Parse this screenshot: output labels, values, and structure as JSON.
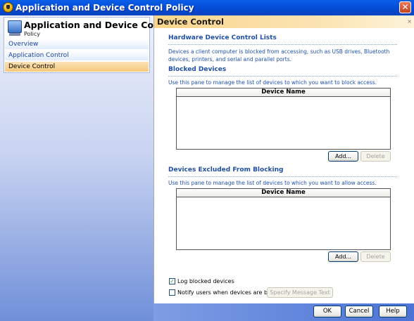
{
  "window": {
    "title": "Application and Device Control Policy",
    "close_glyph": "✕",
    "app_icon": "shield-icon"
  },
  "nav": {
    "heading": "Application and Device Control",
    "subheading": "Policy",
    "items": [
      {
        "label": "Overview",
        "selected": false
      },
      {
        "label": "Application Control",
        "selected": false
      },
      {
        "label": "Device Control",
        "selected": true
      }
    ]
  },
  "panel": {
    "title": "Device Control",
    "close_glyph": "×",
    "section_title": "Hardware Device Control Lists",
    "section_desc": "Devices a client computer is blocked from accessing, such as USB drives, Bluetooth devices, printers, and serial and parallel ports.",
    "blocked": {
      "title": "Blocked Devices",
      "desc": "Use this pane to manage the list of devices to which you want to block access.",
      "column_header": "Device Name",
      "add_label": "Add...",
      "delete_label": "Delete"
    },
    "excluded": {
      "title": "Devices Excluded From Blocking",
      "desc": "Use this pane to manage the list of devices to which you want to allow access.",
      "column_header": "Device Name",
      "add_label": "Add...",
      "delete_label": "Delete"
    },
    "log_blocked": {
      "label": "Log blocked devices",
      "checked": true
    },
    "notify_users": {
      "label": "Notify users when devices are blocked",
      "checked": false
    },
    "specify_message_label": "Specify Message Text"
  },
  "footer": {
    "ok_label": "OK",
    "cancel_label": "Cancel",
    "help_label": "Help"
  },
  "colors": {
    "title_bar": "#0549d2",
    "header_accent": "#f9d58a",
    "section_blue": "#1f4fa8",
    "selected_nav": "#f5c97b"
  }
}
